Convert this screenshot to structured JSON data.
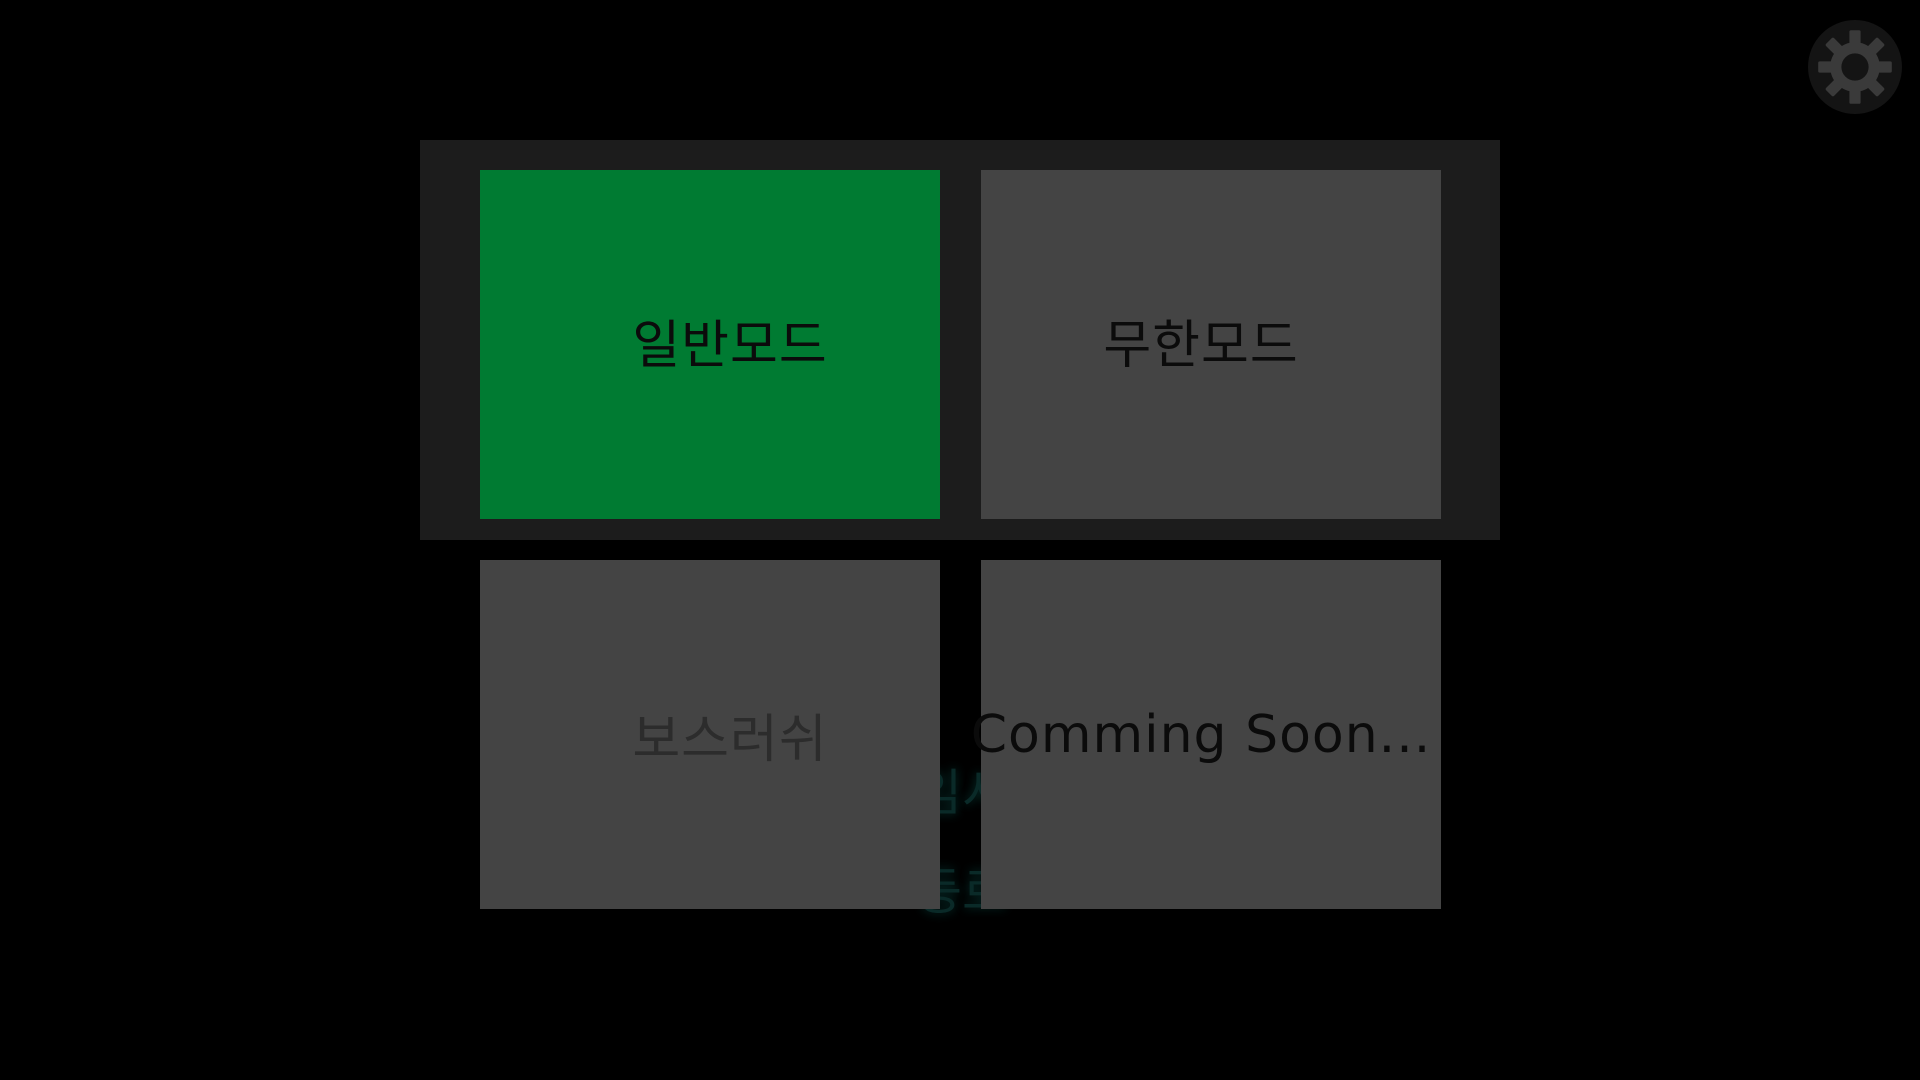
{
  "background_text": {
    "fragment_1": "임시",
    "fragment_2": "등로"
  },
  "mode_menu": {
    "tiles": [
      {
        "label": "일반모드",
        "state": "selected",
        "color": "#007b32"
      },
      {
        "label": "무한모드",
        "state": "normal",
        "color": "#444444"
      },
      {
        "label": "보스러쉬",
        "state": "disabled",
        "color": "#444444"
      },
      {
        "label": "Comming Soon...",
        "state": "normal",
        "color": "#444444"
      }
    ]
  },
  "settings": {
    "icon": "gear-icon"
  },
  "colors": {
    "background": "#000000",
    "panel": "#1c1c1c",
    "tile": "#444444",
    "selected": "#007b32",
    "label": "#0b0b0b",
    "disabled_label": "#2c2c2c"
  }
}
